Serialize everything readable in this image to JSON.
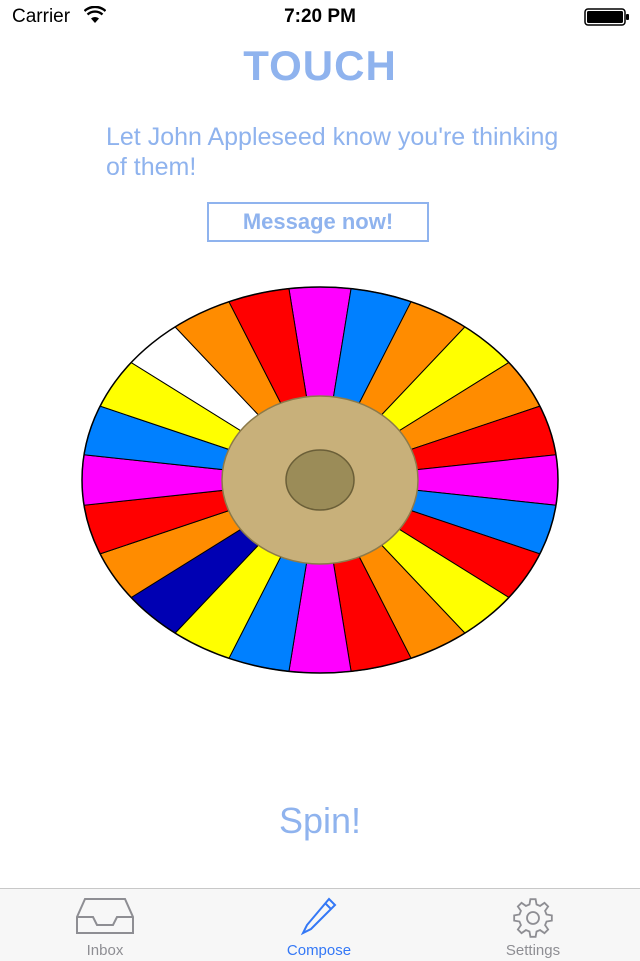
{
  "status_bar": {
    "carrier": "Carrier",
    "time": "7:20 PM",
    "wifi_icon": "wifi-icon",
    "battery_icon": "battery-icon"
  },
  "header": {
    "title": "TOUCH",
    "subtitle": "Let John Appleseed know you're thinking of them!"
  },
  "message_button": {
    "label": "Message now!"
  },
  "wheel": {
    "segment_colors": [
      "#ff00ff",
      "#0080ff",
      "#ff8c00",
      "#ffff00",
      "#ff8c00",
      "#ff0000",
      "#ff00ff",
      "#0080ff",
      "#ff0000",
      "#ffff00",
      "#ff8c00",
      "#ff0000",
      "#ff00ff",
      "#0080ff",
      "#ffff00",
      "#0000b3",
      "#ff8c00",
      "#ff0000",
      "#ff00ff",
      "#0080ff",
      "#ffff00",
      "#ffffff",
      "#ff8c00",
      "#ff0000"
    ],
    "hub_color": "#c8b07a",
    "center_color": "#9b8c58"
  },
  "spin_button": {
    "label": "Spin!"
  },
  "tab_bar": {
    "tabs": [
      {
        "label": "Inbox",
        "icon": "inbox-icon",
        "active": false
      },
      {
        "label": "Compose",
        "icon": "compose-icon",
        "active": true
      },
      {
        "label": "Settings",
        "icon": "gear-icon",
        "active": false
      }
    ],
    "active_color": "#3478f6",
    "inactive_color": "#8e8e93"
  },
  "accent_color": "#8fb3ee"
}
